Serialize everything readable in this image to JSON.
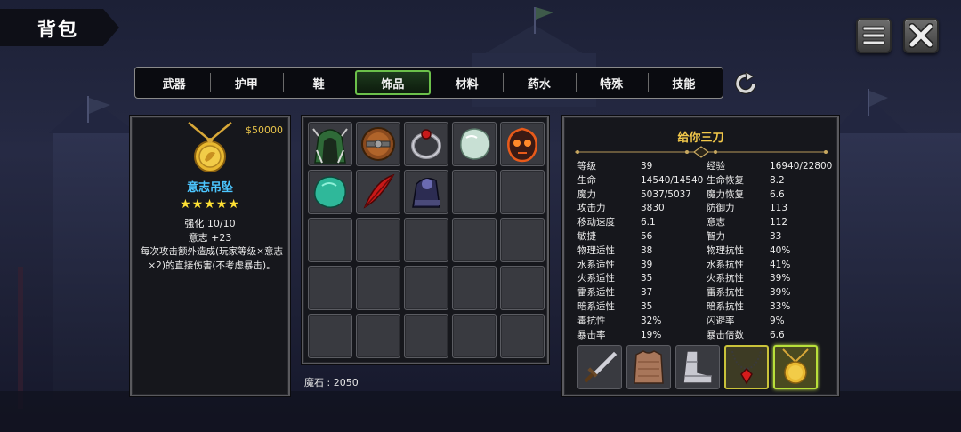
{
  "header": {
    "title": "背包"
  },
  "tabs": [
    {
      "label": "武器",
      "active": false
    },
    {
      "label": "护甲",
      "active": false
    },
    {
      "label": "鞋",
      "active": false
    },
    {
      "label": "饰品",
      "active": true
    },
    {
      "label": "材料",
      "active": false
    },
    {
      "label": "药水",
      "active": false
    },
    {
      "label": "特殊",
      "active": false
    },
    {
      "label": "技能",
      "active": false
    }
  ],
  "item_detail": {
    "price": "$50000",
    "icon": "gold-pendant-icon",
    "name": "意志吊坠",
    "stars": "★★★★★",
    "enhance": "强化 10/10",
    "bonus": "意志 +23",
    "description": "每次攻击额外造成(玩家等级×意志×2)的直接伤害(不考虑暴击)。"
  },
  "inventory": {
    "slots": [
      "green-hood-icon",
      "wooden-shield-icon",
      "ruby-ring-icon",
      "white-stone-icon",
      "fire-skull-icon",
      "jade-stone-icon",
      "red-feather-icon",
      "dark-gauntlet-icon",
      "",
      "",
      "",
      "",
      "",
      "",
      "",
      "",
      "",
      "",
      "",
      "",
      "",
      "",
      "",
      "",
      ""
    ],
    "gem_label": "魔石 : 2050"
  },
  "character": {
    "name": "给你三刀",
    "stats": [
      [
        "等级",
        "39",
        "经验",
        "16940/22800"
      ],
      [
        "生命",
        "14540/14540",
        "生命恢复",
        "8.2"
      ],
      [
        "魔力",
        "5037/5037",
        "魔力恢复",
        "6.6"
      ],
      [
        "攻击力",
        "3830",
        "防御力",
        "113"
      ],
      [
        "移动速度",
        "6.1",
        "意志",
        "112"
      ],
      [
        "敏捷",
        "56",
        "智力",
        "33"
      ],
      [
        "物理适性",
        "38",
        "物理抗性",
        "40%"
      ],
      [
        "水系适性",
        "39",
        "水系抗性",
        "41%"
      ],
      [
        "火系适性",
        "35",
        "火系抗性",
        "39%"
      ],
      [
        "雷系适性",
        "37",
        "雷系抗性",
        "39%"
      ],
      [
        "暗系适性",
        "35",
        "暗系抗性",
        "33%"
      ],
      [
        "毒抗性",
        "32%",
        "闪避率",
        "9%"
      ],
      [
        "暴击率",
        "19%",
        "暴击倍数",
        "6.6"
      ]
    ],
    "equipment": [
      {
        "icon": "dagger-icon",
        "state": "normal"
      },
      {
        "icon": "chainmail-icon",
        "state": "normal"
      },
      {
        "icon": "steel-boots-icon",
        "state": "normal"
      },
      {
        "icon": "ruby-necklace-icon",
        "state": "highlight"
      },
      {
        "icon": "gold-pendant-icon",
        "state": "selected"
      }
    ]
  },
  "colors": {
    "item_name": "#4cc6ff",
    "char_name": "#f2c84a",
    "price": "#e6c24a",
    "stars": "#ffe135",
    "active_tab_border": "#6bc04a"
  }
}
